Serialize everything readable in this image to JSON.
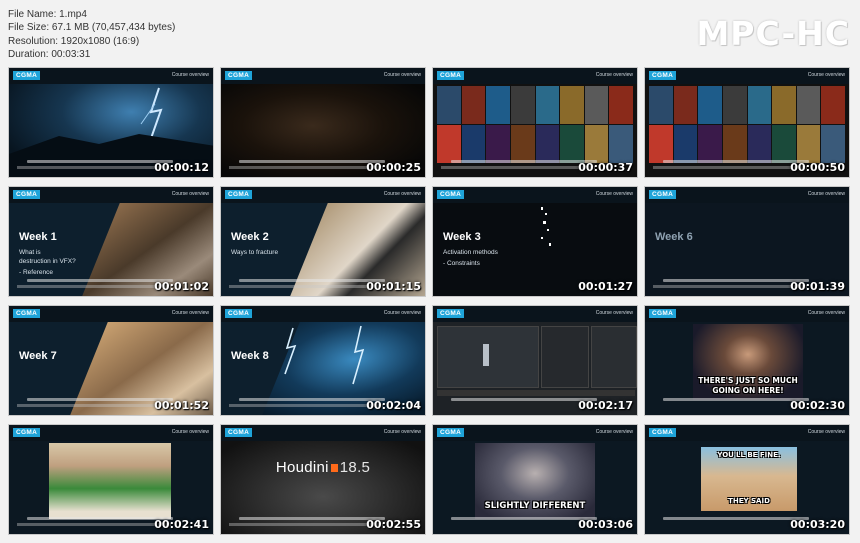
{
  "file_info": {
    "name_line": "File Name: 1.mp4",
    "size_line": "File Size: 67.1 MB (70,457,434 bytes)",
    "resolution_line": "Resolution: 1920x1080 (16:9)",
    "duration_line": "Duration: 00:03:31"
  },
  "brand": "MPC-HC",
  "thumb_common": {
    "logo": "CGMA",
    "top_right": "Course overview"
  },
  "thumbnails": [
    {
      "timestamp": "00:00:12"
    },
    {
      "timestamp": "00:00:25"
    },
    {
      "timestamp": "00:00:37"
    },
    {
      "timestamp": "00:00:50"
    },
    {
      "timestamp": "00:01:02",
      "week": "Week 1",
      "desc1": "What is",
      "desc2": "destruction in VFX?",
      "desc3": "- Reference"
    },
    {
      "timestamp": "00:01:15",
      "week": "Week 2",
      "desc1": "Ways to fracture"
    },
    {
      "timestamp": "00:01:27",
      "week": "Week 3",
      "desc1": "Activation methods",
      "desc2": "- Constraints"
    },
    {
      "timestamp": "00:01:39",
      "week": "Week 6"
    },
    {
      "timestamp": "00:01:52",
      "week": "Week 7"
    },
    {
      "timestamp": "00:02:04",
      "week": "Week 8"
    },
    {
      "timestamp": "00:02:17"
    },
    {
      "timestamp": "00:02:30",
      "caption1": "THERE'S JUST SO MUCH",
      "caption2": "GOING ON HERE!"
    },
    {
      "timestamp": "00:02:41"
    },
    {
      "timestamp": "00:02:55",
      "houdini": "Houdini",
      "houdini_ver": "18.5"
    },
    {
      "timestamp": "00:03:06",
      "caption1": "SLIGHTLY DIFFERENT"
    },
    {
      "timestamp": "00:03:20",
      "caption1": "YOU'LL BE FINE.",
      "caption2": "THEY SAID"
    }
  ],
  "colors": {
    "logo_bg": "#1fa4d9",
    "tile_bg": "#0c1822",
    "page_bg": "#f2f2f2"
  }
}
